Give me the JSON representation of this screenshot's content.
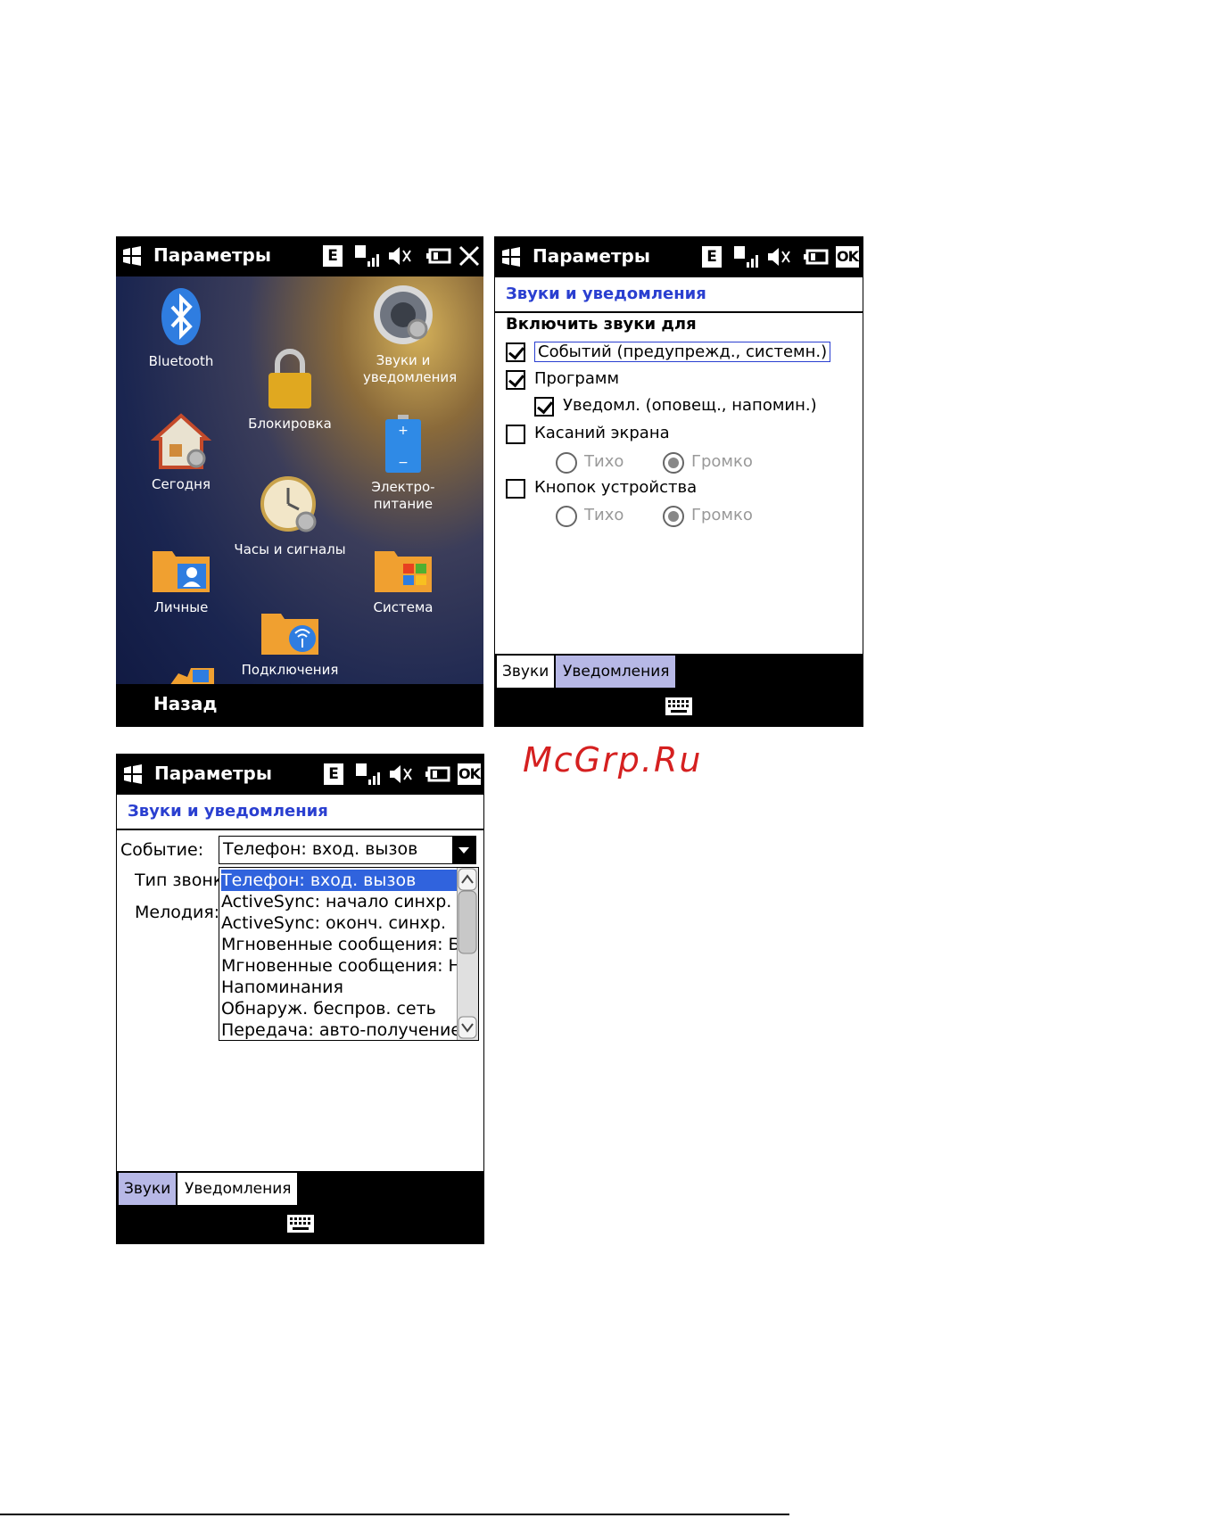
{
  "watermark": "McGrp.Ru",
  "screen1": {
    "title": "Параметры",
    "status_e": "E",
    "apps": [
      {
        "label": "Bluetooth",
        "icon": "bluetooth-icon"
      },
      {
        "label": "Звуки и уведомления",
        "icon": "speaker-gear-icon"
      },
      {
        "label": "Блокировка",
        "icon": "padlock-icon"
      },
      {
        "label": "Сегодня",
        "icon": "house-icon"
      },
      {
        "label": "Электро-питание",
        "icon": "battery-icon"
      },
      {
        "label": "Часы и сигналы",
        "icon": "clock-icon"
      },
      {
        "label": "Личные",
        "icon": "personal-folder-icon"
      },
      {
        "label": "Система",
        "icon": "system-folder-icon"
      },
      {
        "label": "Подключения",
        "icon": "connections-folder-icon"
      }
    ],
    "softkey_left": "Назад"
  },
  "screen2": {
    "title": "Параметры",
    "status_e": "E",
    "ok": "OK",
    "header": "Звуки и уведомления",
    "section": "Включить звуки для",
    "checkboxes": [
      {
        "label": "Событий (предупрежд., системн.)",
        "checked": true
      },
      {
        "label": "Программ",
        "checked": true
      },
      {
        "label": "Уведомл. (оповещ., напомин.)",
        "checked": true
      },
      {
        "label": "Касаний экрана",
        "checked": false
      },
      {
        "label": "Кнопок устройства",
        "checked": false
      }
    ],
    "radio_quiet": "Тихо",
    "radio_loud": "Громко",
    "tabs": [
      "Звуки",
      "Уведомления"
    ]
  },
  "screen3": {
    "title": "Параметры",
    "status_e": "E",
    "ok": "OK",
    "header": "Звуки и уведомления",
    "event_label": "Событие:",
    "ring_type_label": "Тип звонк",
    "melody_label": "Мелодия:",
    "event_value": "Телефон: вход. вызов",
    "options": [
      "Телефон: вход. вызов",
      "ActiveSync: начало синхр.",
      "ActiveSync: оконч. синхр.",
      "Мгновенные сообщения: Б",
      "Мгновенные сообщения: Н",
      "Напоминания",
      "Обнаруж. беспров. сеть",
      "Передача: авто-получение"
    ],
    "tabs": [
      "Звуки",
      "Уведомления"
    ]
  }
}
